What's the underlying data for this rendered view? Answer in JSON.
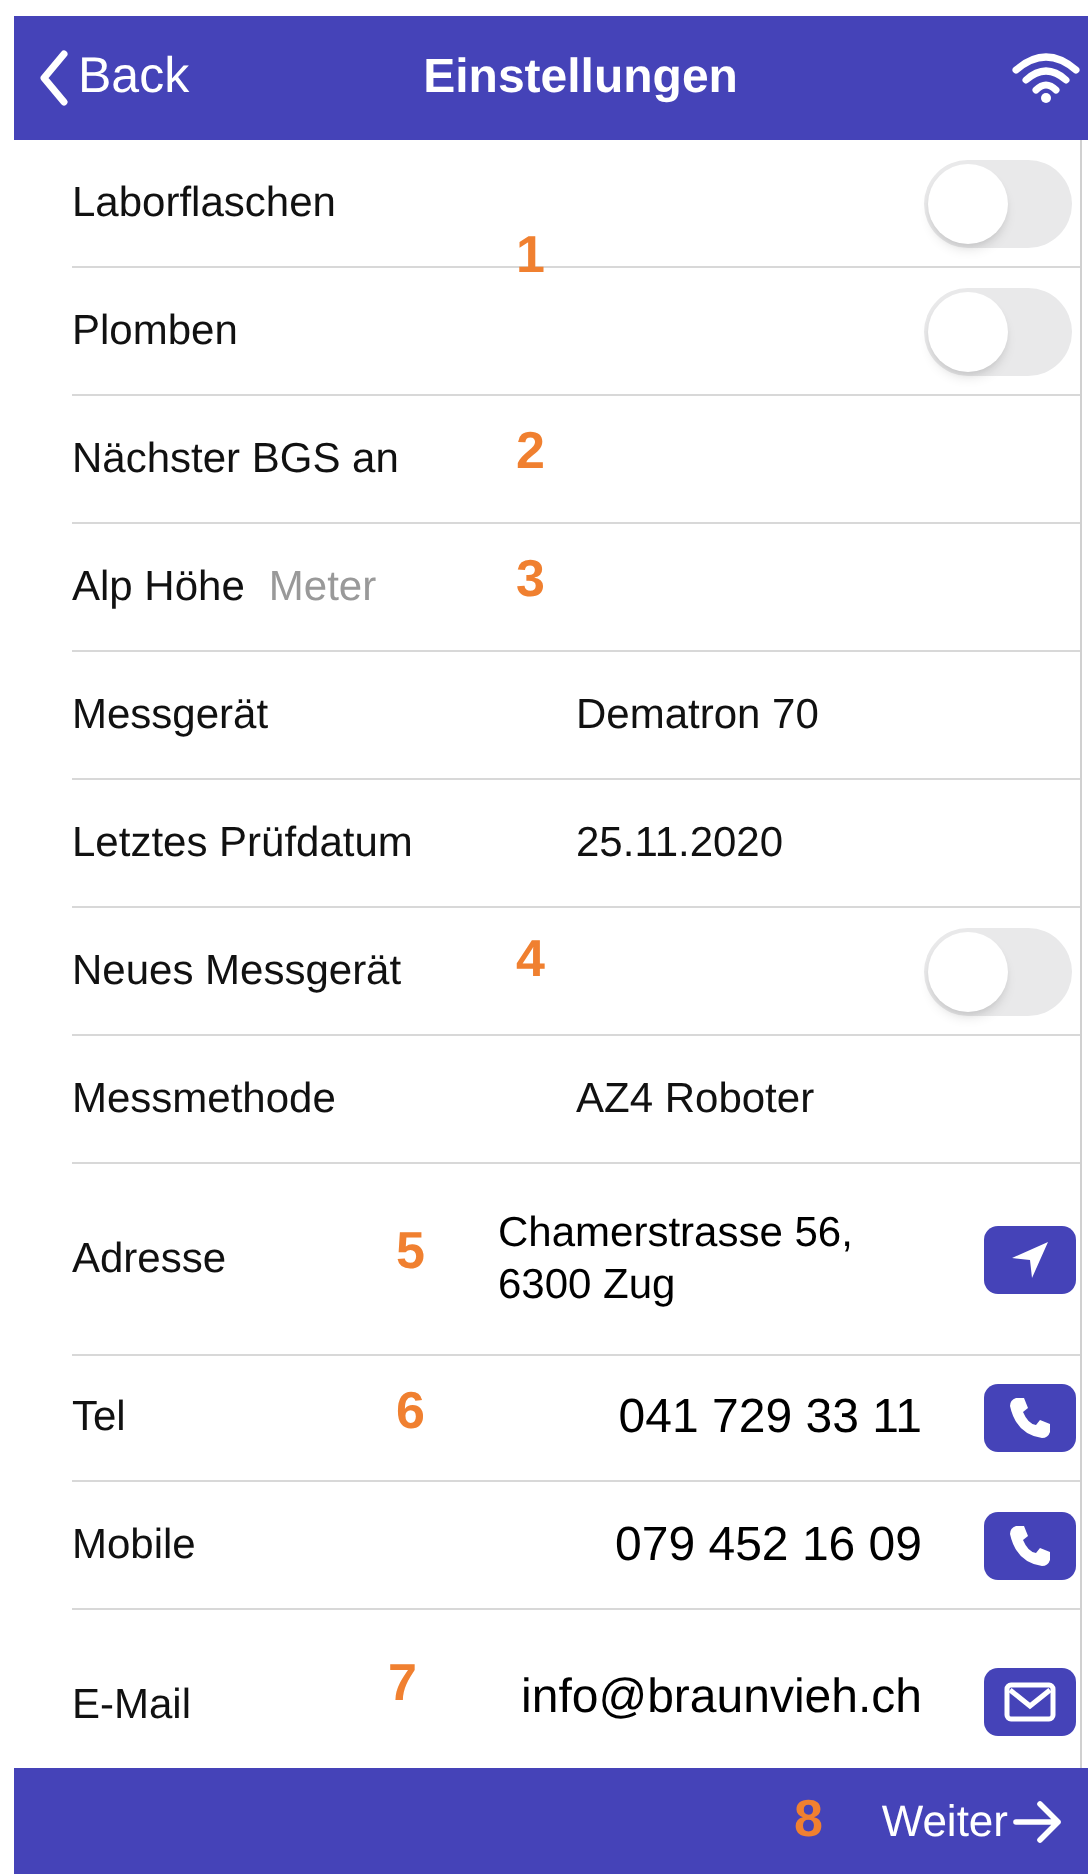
{
  "nav": {
    "back": "Back",
    "title": "Einstellungen"
  },
  "rows": [
    {
      "kind": "toggle",
      "label": "Laborflaschen",
      "on": false
    },
    {
      "kind": "toggle",
      "label": "Plomben",
      "on": false
    },
    {
      "kind": "label",
      "label": "Nächster BGS an"
    },
    {
      "kind": "input",
      "label": "Alp Höhe",
      "placeholder": "Meter"
    },
    {
      "kind": "value",
      "label": "Messgerät",
      "value": "Dematron 70"
    },
    {
      "kind": "value",
      "label": "Letztes Prüfdatum",
      "value": "25.11.2020"
    },
    {
      "kind": "toggle",
      "label": "Neues Messgerät",
      "on": false
    },
    {
      "kind": "value",
      "label": "Messmethode",
      "value": "AZ4 Roboter"
    },
    {
      "kind": "address",
      "label": "Adresse",
      "value": "Chamerstrasse 56,\n6300 Zug"
    },
    {
      "kind": "phone",
      "label": "Tel",
      "value": "041 729 33 11"
    },
    {
      "kind": "phone",
      "label": "Mobile",
      "value": "079 452 16 09"
    },
    {
      "kind": "email",
      "label": "E-Mail",
      "value": "info@braunvieh.ch"
    }
  ],
  "footer": {
    "next": "Weiter"
  },
  "markers": [
    "1",
    "2",
    "3",
    "4",
    "5",
    "6",
    "7",
    "8"
  ]
}
